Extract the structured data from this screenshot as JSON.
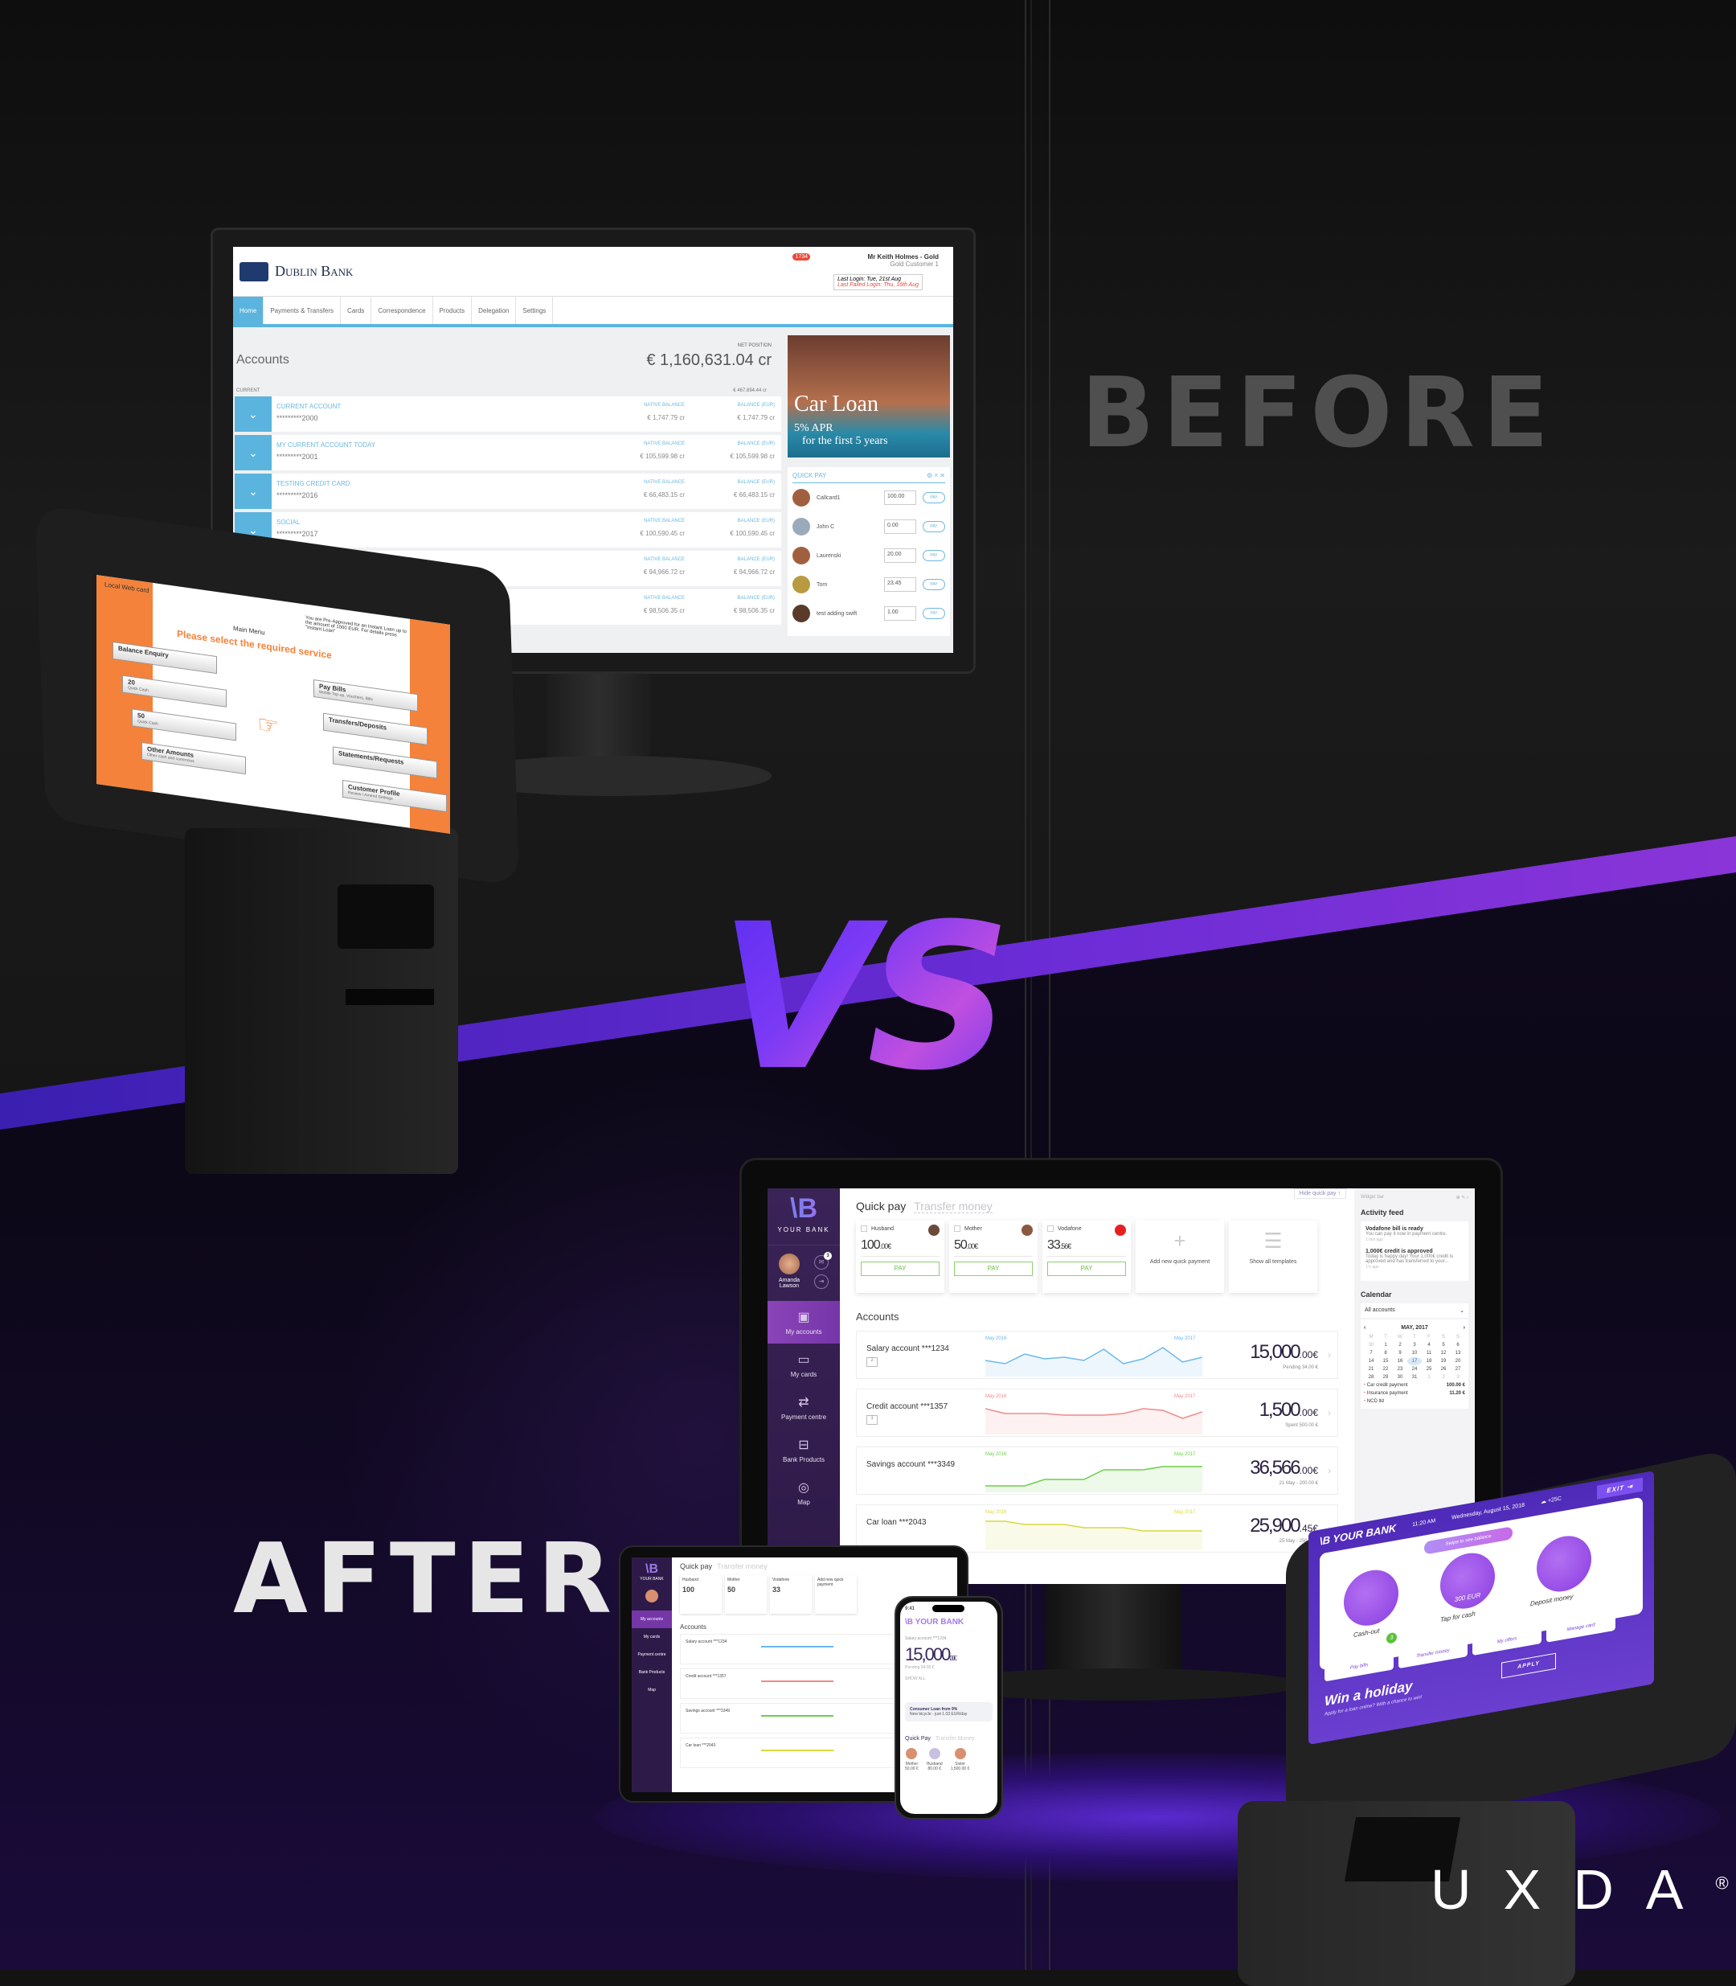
{
  "labels": {
    "before": "BEFORE",
    "after": "AFTER",
    "vs": "VS",
    "brand": "UXDA",
    "registered": "®"
  },
  "old_web": {
    "logo": "Dublin Bank",
    "notification_count": "1734",
    "user_name": "Mr Keith Holmes - Gold",
    "user_tier": "Gold Customer 1",
    "last_login": "Last Login: Tue, 21st Aug",
    "last_failed_login": "Last Failed Login: Thu, 16th Aug",
    "nav": [
      "Home",
      "Payments & Transfers",
      "Cards",
      "Correspondence",
      "Products",
      "Delegation",
      "Settings"
    ],
    "accounts_title": "Accounts",
    "net_position_label": "NET POSITION",
    "net_position": "€ 1,160,631.04 cr",
    "current_label": "CURRENT",
    "current_total": "€ 467,894.44 cr",
    "native_label": "NATIVE BALANCE",
    "eur_label": "BALANCE (EUR)",
    "accounts": [
      {
        "name": "CURRENT ACCOUNT",
        "number": "*********2000",
        "native": "€ 1,747.79 cr",
        "eur": "€ 1,747.79 cr"
      },
      {
        "name": "MY CURRENT ACCOUNT TODAY",
        "number": "*********2001",
        "native": "€ 105,599.98 cr",
        "eur": "€ 105,599.98 cr"
      },
      {
        "name": "TESTING CREDIT CARD",
        "number": "*********2016",
        "native": "€ 66,483.15 cr",
        "eur": "€ 66,483.15 cr"
      },
      {
        "name": "SOCIAL",
        "number": "*********2017",
        "native": "€ 100,590.45 cr",
        "eur": "€ 100,590.45 cr"
      },
      {
        "name": "",
        "number": "",
        "native": "€ 94,966.72 cr",
        "eur": "€ 94,966.72 cr"
      },
      {
        "name": "",
        "number": "",
        "native": "€ 98,506.35 cr",
        "eur": "€ 98,506.35 cr"
      }
    ],
    "banner": {
      "title": "Car Loan",
      "line1": "5% APR",
      "line2": "for the first 5 years"
    },
    "quick_pay": {
      "title": "QUICK PAY",
      "pay_label": "PAY",
      "items": [
        {
          "name": "Callcard1",
          "amount": "100.00"
        },
        {
          "name": "John C",
          "amount": "0.00"
        },
        {
          "name": "Laurenski",
          "amount": "20.00"
        },
        {
          "name": "Tom",
          "amount": "23.45"
        },
        {
          "name": "test adding swift",
          "amount": "1.00"
        }
      ]
    }
  },
  "old_atm": {
    "card": "Local Web card",
    "promo": "You are Pre-Approved for an Instant Loan up to the amount of 1000 EUR. For details press \"Instant Loan\"",
    "menu": "Main Menu",
    "heading": "Please select the required service",
    "left": [
      {
        "label": "Balance Enquiry",
        "sub": ""
      },
      {
        "label": "20",
        "sub": "Quick Cash"
      },
      {
        "label": "50",
        "sub": "Quick Cash"
      },
      {
        "label": "Other Amounts",
        "sub": "Other cash and currencies"
      }
    ],
    "right": [
      {
        "label": "Pay Bills",
        "sub": "Mobile Top-up, Vouchers, Bills"
      },
      {
        "label": "Transfers/Deposits",
        "sub": ""
      },
      {
        "label": "Statements/Requests",
        "sub": ""
      },
      {
        "label": "Customer Profile",
        "sub": "Review / Amend Settings"
      }
    ]
  },
  "new_web": {
    "logo": "\\B",
    "bank_name": "YOUR BANK",
    "user": "Amanda Lawson",
    "mail_count": "3",
    "nav": [
      "My accounts",
      "My cards",
      "Payment centre",
      "Bank Products",
      "Map"
    ],
    "hide_quick_pay": "Hide quick pay ↑",
    "tab_active": "Quick pay",
    "tab_inactive": "Transfer money",
    "pay_label": "PAY",
    "quick_pay": [
      {
        "name": "Husband",
        "amount": "100",
        "cents": ".00€"
      },
      {
        "name": "Mother",
        "amount": "50",
        "cents": ".00€"
      },
      {
        "name": "Vodafone",
        "amount": "33",
        "cents": ".56€"
      }
    ],
    "add_new": "Add new quick payment",
    "show_templates": "Show all templates",
    "accounts_title": "Accounts",
    "range_start": "May 2016",
    "range_end": "May 2017",
    "accounts": [
      {
        "name": "Salary account ***1234",
        "cards": "2",
        "balance": "15,000",
        "cents": ".00€",
        "sub": "Pending 34.00 €",
        "color": "#6bb8f0",
        "trend": [
          0.4,
          0.3,
          0.6,
          0.45,
          0.5,
          0.4,
          0.75,
          0.3,
          0.45,
          0.8,
          0.35,
          0.5
        ]
      },
      {
        "name": "Credit account ***1357",
        "cards": "1",
        "balance": "1,500",
        "cents": ".00€",
        "sub": "Spent 500.00 €",
        "color": "#f08a8a",
        "trend": [
          0.7,
          0.55,
          0.55,
          0.55,
          0.5,
          0.5,
          0.5,
          0.55,
          0.7,
          0.65,
          0.4,
          0.6
        ]
      },
      {
        "name": "Savings account ***3349",
        "cards": "",
        "balance": "36,566",
        "cents": ".00€",
        "sub": "21 May - 200.00 €",
        "color": "#6ccf48",
        "trend": [
          0.1,
          0.1,
          0.1,
          0.3,
          0.3,
          0.3,
          0.6,
          0.6,
          0.6,
          0.7,
          0.7,
          0.7
        ]
      },
      {
        "name": "Car loan ***2043",
        "cards": "",
        "balance": "25,900",
        "cents": ".45€",
        "sub": "25 May - 250.00 €",
        "color": "#d8d840",
        "trend": [
          0.8,
          0.8,
          0.7,
          0.7,
          0.7,
          0.6,
          0.6,
          0.6,
          0.5,
          0.5,
          0.5,
          0.5
        ]
      }
    ],
    "widget": {
      "bar_label": "Widget bar",
      "feed_title": "Activity feed",
      "feed": [
        {
          "title": "Vodafone bill is ready",
          "text": "You can pay it now in payment centre.",
          "time": "1 min ago"
        },
        {
          "title": "1,000€ credit is approved",
          "text": "Today is happy day! Your 1,000€ credit is approved and has transferred to your...",
          "time": "1 h ago"
        }
      ],
      "calendar_title": "Calendar",
      "account_filter": "All accounts",
      "month": "MAY, 2017",
      "weekdays": [
        "M",
        "T",
        "W",
        "T",
        "F",
        "S",
        "S"
      ],
      "weeks": [
        [
          "30",
          "1",
          "2",
          "3",
          "4",
          "5",
          "6"
        ],
        [
          "7",
          "8",
          "9",
          "10",
          "11",
          "12",
          "13"
        ],
        [
          "14",
          "15",
          "16",
          "17",
          "18",
          "19",
          "20"
        ],
        [
          "21",
          "22",
          "23",
          "24",
          "25",
          "26",
          "27"
        ],
        [
          "28",
          "29",
          "30",
          "31",
          "1",
          "2",
          "3"
        ]
      ],
      "today": "17",
      "events": [
        {
          "name": "Car credit payment",
          "amount": "100.00 €"
        },
        {
          "name": "Insurance payment",
          "amount": "11.20 €"
        },
        {
          "name": "NCD ltd",
          "amount": ""
        }
      ]
    }
  },
  "mobile": {
    "time": "9:41",
    "logo": "\\B YOUR BANK",
    "account": "Salary account ***1234",
    "balance": "15,000",
    "cents": ".00€",
    "pending": "Pending 34.00 €",
    "show_all": "SHOW ALL",
    "promo_title": "Consumer Loan from 9%",
    "promo_text": "New bicycle - just 1.03 EUR/day",
    "tab_active": "Quick Pay",
    "tab_inactive": "Transfer Money",
    "contacts": [
      {
        "name": "Mother",
        "amount": "50.00 €"
      },
      {
        "name": "Husband",
        "amount": "80.00 €"
      },
      {
        "name": "Sister",
        "amount": "1,500.00 €"
      }
    ]
  },
  "new_atm": {
    "logo": "\\B YOUR BANK",
    "time": "11:20 AM",
    "date": "Wednesday, August 15, 2018",
    "weather": "+25C",
    "exit": "EXIT",
    "swipe": "Swipe to see balance",
    "actions": [
      {
        "label": "Cash-out",
        "value": ""
      },
      {
        "label": "Tap for cash",
        "value": "300 EUR"
      },
      {
        "label": "Deposit money",
        "value": ""
      }
    ],
    "tiles": [
      {
        "label": "Pay bills",
        "badge": "3"
      },
      {
        "label": "Transfer money",
        "badge": ""
      },
      {
        "label": "My offers",
        "badge": ""
      },
      {
        "label": "Manage card",
        "badge": ""
      }
    ],
    "promo_title": "Win a holiday",
    "promo_text": "Apply for a loan online? With a chance to win!",
    "apply": "APPLY"
  }
}
